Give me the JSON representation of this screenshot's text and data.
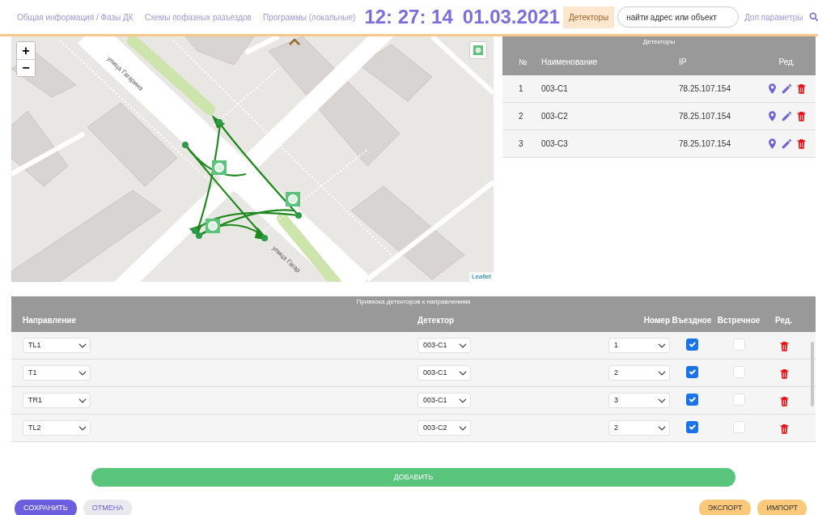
{
  "header": {
    "items": [
      {
        "kind": "tab",
        "label": "Общая информация / Фазы ДК",
        "selected": false
      },
      {
        "kind": "tab",
        "label": "Схемы пофазных разъездов",
        "selected": false
      },
      {
        "kind": "tab",
        "label": "Программы (локальные)",
        "selected": false
      },
      {
        "kind": "clock",
        "time": "12: 27: 14",
        "date": "01.03.2021"
      },
      {
        "kind": "tab",
        "label": "Детекторы",
        "selected": true
      },
      {
        "kind": "search",
        "placeholder": "найти адрес или объект"
      },
      {
        "kind": "tab",
        "label": "Доп параметры",
        "selected": false
      }
    ]
  },
  "map": {
    "streets": [
      "улица Гагарина",
      "улица Гагар"
    ],
    "attribution": "Leaflet",
    "zoom_in": "+",
    "zoom_out": "−"
  },
  "detectors": {
    "title": "Детекторы",
    "columns": [
      "№",
      "Наименование",
      "IP",
      "Ред."
    ],
    "rows": [
      {
        "number": "1",
        "name": "003-C1",
        "ip": "78.25.107.154"
      },
      {
        "number": "2",
        "name": "003-C2",
        "ip": "78.25.107.154"
      },
      {
        "number": "3",
        "name": "003-C3",
        "ip": "78.25.107.154"
      }
    ]
  },
  "bindings": {
    "title": "Привязка детекторов к направлениям",
    "columns": [
      "Направление",
      "Детектор",
      "Номер",
      "Въездное",
      "Встречное",
      "Ред."
    ],
    "rows": [
      {
        "direction": "TL1",
        "detector": "003-C1",
        "number": "1",
        "entry": true,
        "oncoming": false
      },
      {
        "direction": "T1",
        "detector": "003-C1",
        "number": "2",
        "entry": true,
        "oncoming": false
      },
      {
        "direction": "TR1",
        "detector": "003-C1",
        "number": "3",
        "entry": true,
        "oncoming": false
      },
      {
        "direction": "TL2",
        "detector": "003-C2",
        "number": "2",
        "entry": true,
        "oncoming": false
      }
    ]
  },
  "add_button": "ДОБАВИТЬ",
  "actions": [
    {
      "label": "СОХРАНИТЬ",
      "kind": "primary"
    },
    {
      "label": "ОТМЕНА",
      "kind": "secondary"
    },
    {
      "label": "ЭКСПОРТ",
      "kind": "warning"
    },
    {
      "label": "ИМПОРТ",
      "kind": "warning"
    }
  ]
}
